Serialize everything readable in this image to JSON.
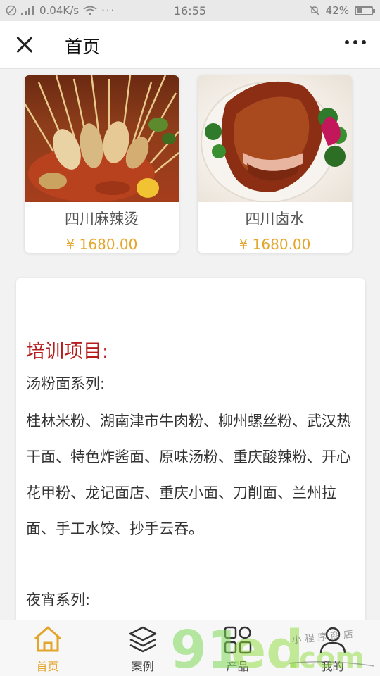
{
  "status_bar": {
    "speed": "0.04K/s",
    "time": "16:55",
    "battery": "42%",
    "battery_level": 0.42
  },
  "nav": {
    "title": "首页"
  },
  "products": [
    {
      "name": "四川麻辣烫",
      "price": "¥ 1680.00",
      "image": "malatang-photo"
    },
    {
      "name": "四川卤水",
      "price": "¥ 1680.00",
      "image": "braised-pork-photo"
    }
  ],
  "article": {
    "heading": "培训项目:",
    "subheading1": "汤粉面系列:",
    "paragraph": "桂林米粉、湖南津市牛肉粉、柳州螺丝粉、武汉热干面、特色炸酱面、原味汤粉、重庆酸辣粉、开心花甲粉、龙记面店、重庆小面、刀削面、兰州拉面、手工水饺、抄手云吞。",
    "subheading2": "夜宵系列:"
  },
  "tabs": [
    {
      "label": "首页",
      "icon": "home-icon",
      "active": true
    },
    {
      "label": "案例",
      "icon": "layers-icon",
      "active": false
    },
    {
      "label": "产品",
      "icon": "grid-icon",
      "active": false
    },
    {
      "label": "我的",
      "icon": "user-icon",
      "active": false
    }
  ],
  "watermark": {
    "logo": "91ed.com",
    "handwriting": "小程序商店"
  },
  "colors": {
    "accent": "#e3a52a",
    "heading_red": "#b71c1c"
  }
}
